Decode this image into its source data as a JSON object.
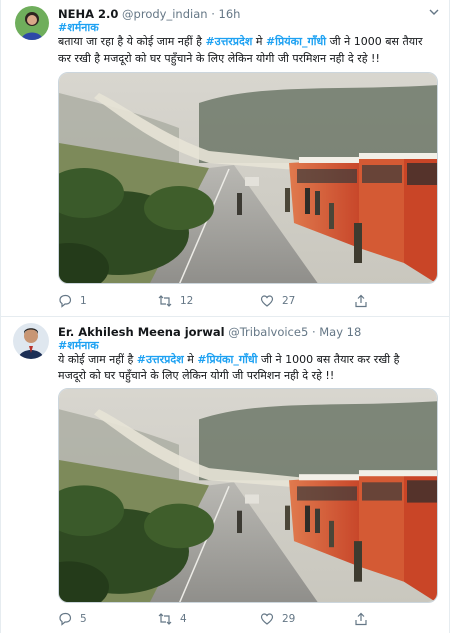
{
  "tweets": [
    {
      "name": "NEHA 2.0",
      "handle": "@prody_indian",
      "separator": "·",
      "time": "16h",
      "tag": "#शर्मनाक",
      "line1": {
        "pre": "बताया जा रहा है ये कोई जाम नहीं है ",
        "hash1": "#उत्तरप्रदेश",
        "mid": " मे ",
        "hash2": "#प्रियंका_गाँधी",
        "post": " जी ने  1000 बस तैयार"
      },
      "line2": "कर रखी है मजदूरो को घर पहुँचाने के लिए  लेकिन योगी जी  परमिशन नही दे रहे !!",
      "counts": {
        "reply": "1",
        "retweet": "12",
        "like": "27"
      }
    },
    {
      "name": "Er. Akhilesh Meena jorwal",
      "handle": "@Tribalvoice5",
      "separator": "·",
      "time": "May 18",
      "tag": "#शर्मनाक",
      "line1": {
        "pre": "ये कोई जाम नहीं है ",
        "hash1": "#उत्तरप्रदेश",
        "mid": " मे ",
        "hash2": "#प्रियंका_गाँधी",
        "post": " जी ने  1000 बस तैयार कर रखी है"
      },
      "line2": "मजदूरो को घर पहुँचाने के लिए  लेकिन योगी जी  परमिशन नही दे रहे !!",
      "counts": {
        "reply": "5",
        "retweet": "4",
        "like": "29"
      }
    }
  ],
  "colors": {
    "accent": "#1da1f2",
    "muted": "#657786",
    "divider": "#e6ecf0",
    "bus": "#d8532f"
  },
  "icons": [
    "reply-icon",
    "retweet-icon",
    "like-icon",
    "share-icon",
    "chevron-down-icon"
  ]
}
